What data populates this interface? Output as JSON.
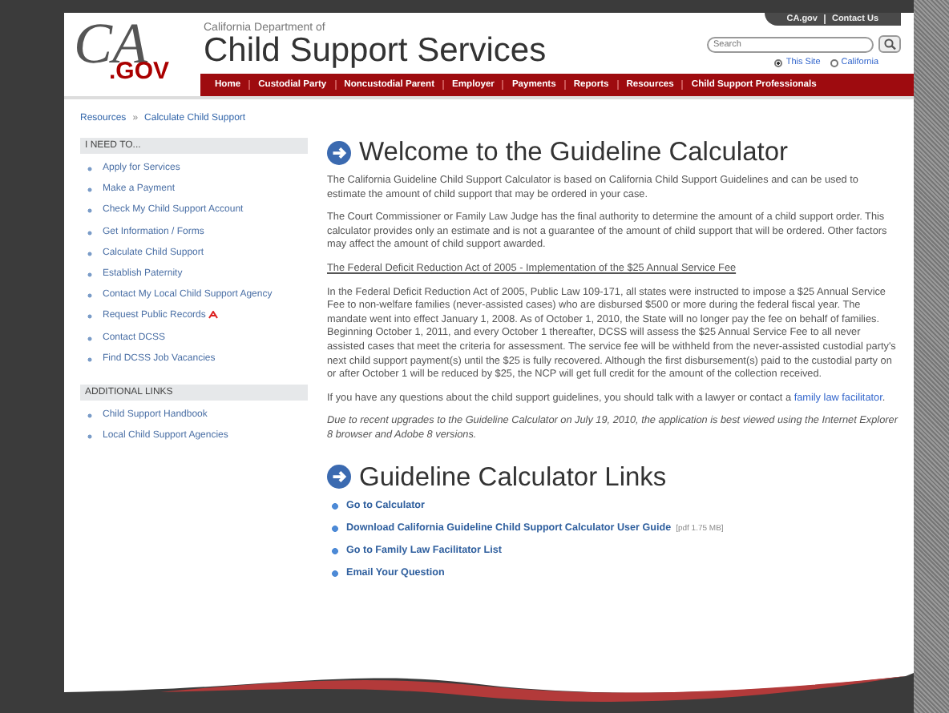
{
  "header": {
    "logo": {
      "script": "CA",
      "suffix": ".GOV"
    },
    "agency_line": "California Department of",
    "title": "Child Support Services",
    "top_links": [
      "CA.gov",
      "Contact Us"
    ],
    "search": {
      "placeholder": "Search"
    },
    "search_scope": [
      {
        "label": "This Site",
        "selected": true
      },
      {
        "label": "California",
        "selected": false
      }
    ],
    "nav": [
      "Home",
      "Custodial Party",
      "Noncustodial Parent",
      "Employer",
      "Payments",
      "Reports",
      "Resources",
      "Child Support Professionals"
    ]
  },
  "breadcrumb": {
    "items": [
      "Resources",
      "Calculate Child Support"
    ],
    "separator": "»"
  },
  "sidebar": {
    "sections": [
      {
        "title": "I NEED TO...",
        "items": [
          {
            "label": "Apply for Services",
            "pdf": false
          },
          {
            "label": "Make a Payment",
            "pdf": false
          },
          {
            "label": "Check My Child Support Account",
            "pdf": false
          },
          {
            "label": "Get Information / Forms",
            "pdf": false
          },
          {
            "label": "Calculate Child Support",
            "pdf": false
          },
          {
            "label": "Establish Paternity",
            "pdf": false
          },
          {
            "label": "Contact My Local Child Support Agency",
            "pdf": false
          },
          {
            "label": "Request Public Records",
            "pdf": true
          },
          {
            "label": "Contact DCSS",
            "pdf": false
          },
          {
            "label": "Find DCSS Job Vacancies",
            "pdf": false
          }
        ]
      },
      {
        "title": "ADDITIONAL LINKS",
        "items": [
          {
            "label": "Child Support Handbook",
            "pdf": false
          },
          {
            "label": "Local Child Support Agencies",
            "pdf": false
          }
        ]
      }
    ]
  },
  "main": {
    "heading": "Welcome to the Guideline Calculator",
    "blocks": [
      {
        "kind": "paragraph",
        "text": "The California Guideline Child Support Calculator is based on California Child Support Guidelines and can be used to estimate the amount of child support that may be ordered in your case."
      },
      {
        "kind": "paragraph",
        "text": "The Court Commissioner or Family Law Judge has the final authority to determine the amount of a child support order. This calculator provides only an estimate and is not a guarantee of the amount of child support that will be ordered. Other factors may affect the amount of child support awarded."
      },
      {
        "kind": "link",
        "text": "The Federal Deficit Reduction Act of 2005 - Implementation of the $25 Annual Service Fee"
      },
      {
        "kind": "paragraph",
        "text": "In the Federal Deficit Reduction Act of 2005, Public Law 109-171, all states were instructed to impose a $25 Annual Service Fee to non-welfare families (never-assisted cases) who are disbursed $500 or more during the federal fiscal year. The mandate went into effect January 1, 2008. As of October 1, 2010, the State will no longer pay the fee on behalf of families. Beginning October 1, 2011, and every October 1 thereafter, DCSS will assess the $25 Annual Service Fee to all never assisted cases that meet the criteria for assessment. The service fee will be withheld from the never-assisted custodial party's next child support payment(s) until the $25 is fully recovered. Although the first disbursement(s) paid to the custodial party on or after October 1 will be reduced by $25, the NCP will get full credit for the amount of the collection received."
      },
      {
        "kind": "paragraph",
        "text": "If you have any questions about the child support guidelines, you should talk with a lawyer or contact a ",
        "link": "family law facilitator",
        "after": "."
      },
      {
        "kind": "note",
        "text": "Due to recent upgrades to the Guideline Calculator on July 19, 2010, the application is best viewed using the Internet Explorer 8 browser and Adobe 8 versions."
      }
    ],
    "links_heading": "Guideline Calculator Links",
    "links": [
      {
        "label": "Go to Calculator"
      },
      {
        "label": "Download California Guideline Child Support Calculator User Guide",
        "note": "[pdf 1.75 MB]"
      },
      {
        "label": "Go to Family Law Facilitator List"
      },
      {
        "label": "Email Your Question"
      }
    ]
  }
}
